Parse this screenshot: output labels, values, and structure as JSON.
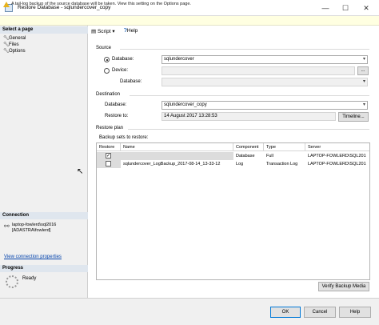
{
  "window": {
    "title": "Restore Database - sqlundercover_copy",
    "minimize_glyph": "—",
    "maximize_glyph": "☐",
    "close_glyph": "✕"
  },
  "infobar": {
    "text": "A tail-log backup of the source database will be taken. View this setting on the Options page."
  },
  "left_panel": {
    "select_page_header": "Select a page",
    "pages": [
      {
        "label": "General"
      },
      {
        "label": "Files"
      },
      {
        "label": "Options"
      }
    ],
    "connection_header": "Connection",
    "connection_server": "laptop-fowlerd\\sql2016",
    "connection_user": "[ADASTRA\\fowlerd]",
    "view_connection_link": "View connection properties",
    "progress_header": "Progress",
    "progress_status": "Ready"
  },
  "toolbar": {
    "script_label": "Script",
    "help_label": "Help"
  },
  "source": {
    "header": "Source",
    "database_radio_label": "Database:",
    "database_value": "sqlundercover",
    "device_radio_label": "Device:",
    "device_value": "",
    "device_browse": "...",
    "database_label": "Database:",
    "device_database_value": ""
  },
  "destination": {
    "header": "Destination",
    "database_label": "Database:",
    "database_value": "sqlundercover_copy",
    "restore_to_label": "Restore to:",
    "restore_to_value": "14 August 2017 13:28:53",
    "timeline_button": "Timeline..."
  },
  "restore_plan": {
    "header": "Restore plan",
    "sets_label": "Backup sets to restore:",
    "columns": [
      "Restore",
      "Name",
      "Component",
      "Type",
      "Server"
    ],
    "rows": [
      {
        "restore": true,
        "name": "",
        "component": "Database",
        "type": "Full",
        "server": "LAPTOP-FOWLERD\\SQL201"
      },
      {
        "restore": false,
        "name": "sqlundercover_LogBackup_2017-08-14_13-33-12",
        "component": "Log",
        "type": "Transaction Log",
        "server": "LAPTOP-FOWLERD\\SQL201"
      }
    ],
    "verify_button": "Verify Backup Media"
  },
  "footer": {
    "ok_button": "OK",
    "cancel_button": "Cancel",
    "help_button": "Help"
  },
  "colors": {
    "accent": "#0078d7",
    "link": "#0645ad",
    "infobar_bg": "#ffffe1"
  }
}
